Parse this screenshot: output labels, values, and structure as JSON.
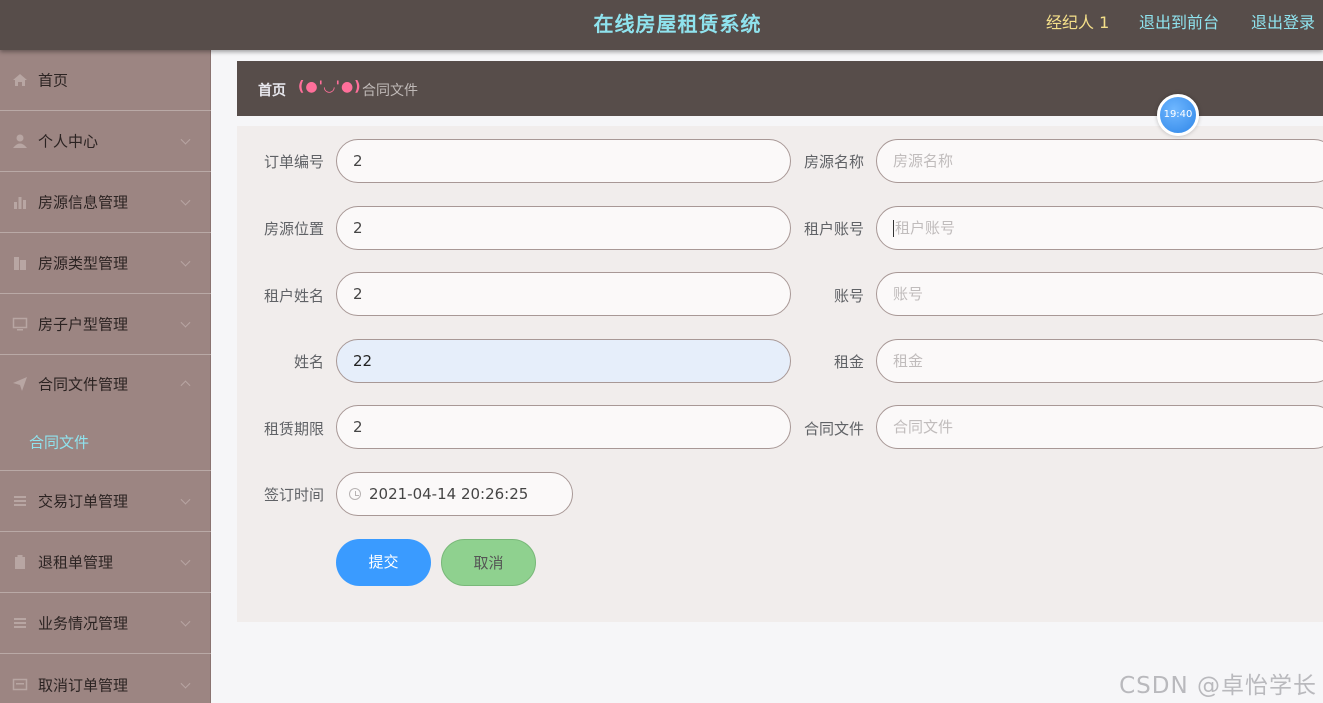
{
  "header": {
    "title": "在线房屋租赁系统",
    "user": "经纪人 1",
    "front_link": "退出到前台",
    "logout_link": "退出登录"
  },
  "sidebar": {
    "items": [
      {
        "label": "首页",
        "icon": "home-icon"
      },
      {
        "label": "个人中心",
        "icon": "user-icon"
      },
      {
        "label": "房源信息管理",
        "icon": "bar-chart-icon"
      },
      {
        "label": "房源类型管理",
        "icon": "building-icon"
      },
      {
        "label": "房子户型管理",
        "icon": "monitor-icon"
      },
      {
        "label": "合同文件管理",
        "icon": "send-icon"
      },
      {
        "label": "交易订单管理",
        "icon": "list-icon"
      },
      {
        "label": "退租单管理",
        "icon": "clipboard-icon"
      },
      {
        "label": "业务情况管理",
        "icon": "list-icon"
      },
      {
        "label": "取消订单管理",
        "icon": "message-icon"
      }
    ],
    "submenu": {
      "label": "合同文件"
    }
  },
  "breadcrumb": {
    "home": "首页",
    "separator": "(●'◡'●)",
    "current": "合同文件"
  },
  "time_bubble": "19:40",
  "form": {
    "order_no": {
      "label": "订单编号",
      "value": "2"
    },
    "house_name": {
      "label": "房源名称",
      "placeholder": "房源名称"
    },
    "house_location": {
      "label": "房源位置",
      "value": "2"
    },
    "tenant_account": {
      "label": "租户账号",
      "placeholder": "租户账号"
    },
    "tenant_name": {
      "label": "租户姓名",
      "value": "2"
    },
    "account": {
      "label": "账号",
      "placeholder": "账号"
    },
    "name": {
      "label": "姓名",
      "value": "22"
    },
    "rent": {
      "label": "租金",
      "placeholder": "租金"
    },
    "lease_term": {
      "label": "租赁期限",
      "value": "2"
    },
    "contract_file": {
      "label": "合同文件",
      "placeholder": "合同文件"
    },
    "sign_time": {
      "label": "签订时间",
      "value": "2021-04-14 20:26:25"
    },
    "submit_label": "提交",
    "cancel_label": "取消"
  },
  "watermark": "CSDN @卓怡学长",
  "colors": {
    "topbar": "#574d4a",
    "sidebar": "#9c8582",
    "accent_cyan": "#8fe3ee",
    "submit": "#3a9bff",
    "cancel": "#8fd18f"
  }
}
